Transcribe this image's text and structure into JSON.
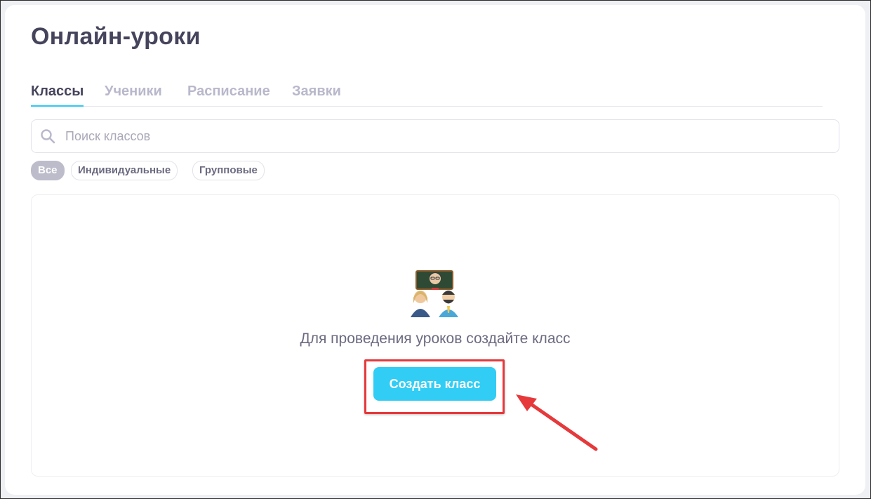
{
  "page": {
    "title": "Онлайн-уроки"
  },
  "tabs": [
    {
      "label": "Классы",
      "active": true
    },
    {
      "label": "Ученики",
      "active": false
    },
    {
      "label": "Расписание",
      "active": false
    },
    {
      "label": "Заявки",
      "active": false
    }
  ],
  "search": {
    "placeholder": "Поиск классов",
    "value": "",
    "icon": "search-icon"
  },
  "filters": [
    {
      "label": "Все",
      "active": true
    },
    {
      "label": "Индивидуальные",
      "active": false
    },
    {
      "label": "Групповые",
      "active": false
    }
  ],
  "empty_state": {
    "illustration": "teachers-illustration",
    "message": "Для проведения уроков создайте класс",
    "button_label": "Создать класс"
  },
  "colors": {
    "accent": "#31cdf5",
    "tab_underline": "#2ec8f2",
    "title_text": "#45445c",
    "inactive_tab": "#b9b8cb",
    "annotation_red": "#e5393b"
  }
}
